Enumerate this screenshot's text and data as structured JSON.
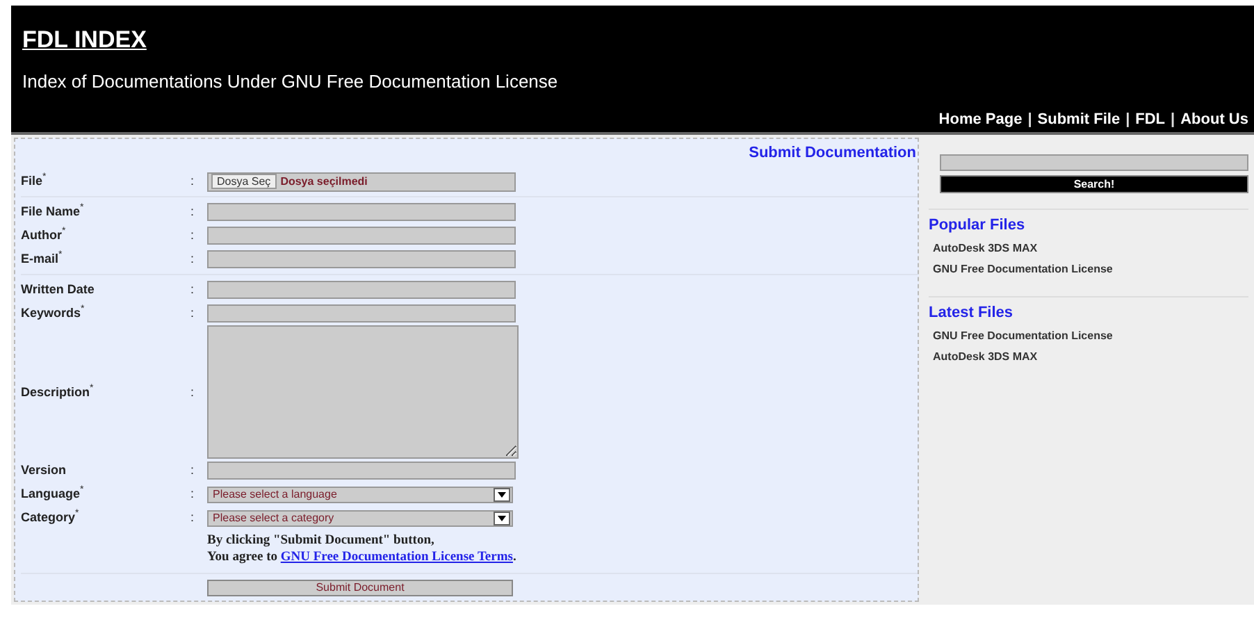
{
  "header": {
    "title": "FDL INDEX",
    "subtitle": "Index of Documentations Under GNU Free Documentation License",
    "nav": [
      {
        "kind": "link",
        "text": "Home Page"
      },
      {
        "kind": "separator",
        "text": "|"
      },
      {
        "kind": "link",
        "text": "Submit File"
      },
      {
        "kind": "separator",
        "text": "|"
      },
      {
        "kind": "link",
        "text": "FDL"
      },
      {
        "kind": "separator",
        "text": "|"
      },
      {
        "kind": "link",
        "text": "About Us"
      }
    ]
  },
  "form": {
    "heading": "Submit Documentation",
    "groups": [
      [
        {
          "kind": "file",
          "label": "File$^{*}$",
          "colon": ":",
          "button": "Dosya Seç",
          "status": "Dosya seçilmedi"
        }
      ],
      [
        {
          "kind": "text",
          "label": "File Name$^{*}$",
          "colon": ":"
        },
        {
          "kind": "text",
          "label": "Author$^{*}$",
          "colon": ":"
        },
        {
          "kind": "text",
          "label": "E-mail$^{*}$",
          "colon": ":"
        }
      ],
      [
        {
          "kind": "text",
          "label": "Written Date",
          "colon": ":"
        },
        {
          "kind": "text",
          "label": "Keywords$^{*}$",
          "colon": ":"
        },
        {
          "kind": "textarea",
          "label": "Description$^{*}$",
          "colon": ":"
        },
        {
          "kind": "text",
          "label": "Version",
          "colon": ":"
        },
        {
          "kind": "select",
          "label": "Language$^{*}$",
          "colon": ":",
          "placeholder": "Please select a language"
        },
        {
          "kind": "select",
          "label": "Category$^{*}$",
          "colon": ":",
          "placeholder": "Please select a category"
        }
      ]
    ],
    "terms_line1": "By clicking \"Submit Document\" button,",
    "terms_prefix": "You agree to",
    "terms_link": "GNU Free Documentation License Terms",
    "terms_suffix": ".",
    "submit": "Submit Document"
  },
  "sidebar": {
    "search_button": "Search!",
    "sections": [
      {
        "title": "Popular Files",
        "items": [
          "AutoDesk 3DS MAX",
          "GNU Free Documentation License"
        ]
      },
      {
        "title": "Latest Files",
        "items": [
          "GNU Free Documentation License",
          "AutoDesk 3DS MAX"
        ]
      }
    ]
  }
}
